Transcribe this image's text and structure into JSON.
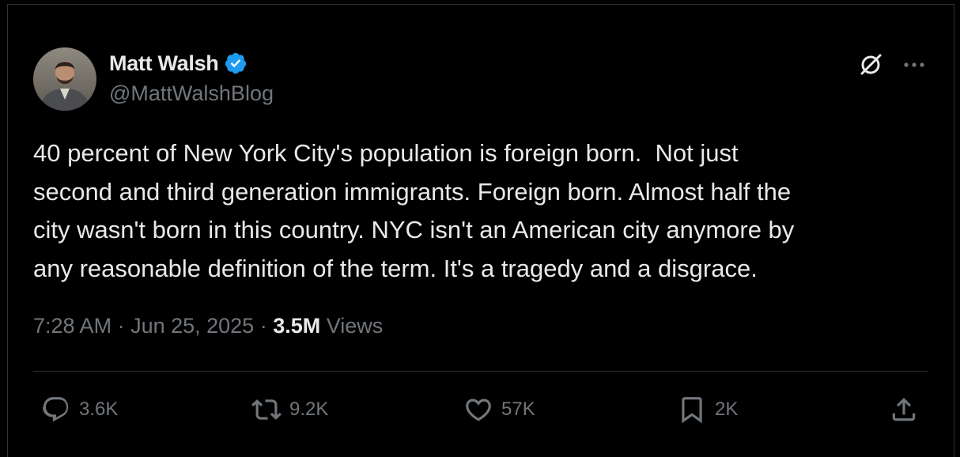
{
  "author": {
    "display_name": "Matt Walsh",
    "handle": "@MattWalshBlog",
    "verified": true
  },
  "tweet": {
    "text": "40 percent of New York City's population is foreign born.  Not just\nsecond and third generation immigrants. Foreign born. Almost half the\ncity wasn't born in this country. NYC isn't an American city anymore by\nany reasonable definition of the term. It's a tragedy and a disgrace.",
    "time": "7:28 AM",
    "separator": " · ",
    "date": "Jun 25, 2025",
    "views_count": "3.5M",
    "views_label": " Views"
  },
  "actions": {
    "replies": "3.6K",
    "reposts": "9.2K",
    "likes": "57K",
    "bookmarks": "2K"
  },
  "icons": {
    "verified": "verified-badge-icon",
    "grok": "grok-icon",
    "more": "more-icon",
    "reply": "reply-icon",
    "repost": "repost-icon",
    "like": "heart-icon",
    "bookmark": "bookmark-icon",
    "share": "share-icon"
  },
  "colors": {
    "background": "#000000",
    "text": "#e7e9ea",
    "secondary": "#71767b",
    "verified_blue": "#1d9bf0",
    "border": "#2f3336"
  }
}
